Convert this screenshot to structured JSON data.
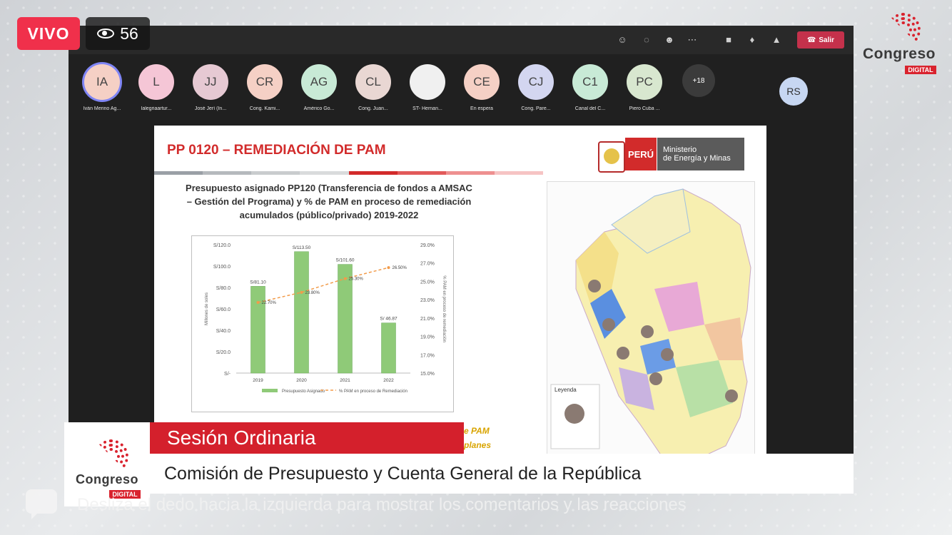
{
  "badges": {
    "live": "VIVO",
    "viewers": "56"
  },
  "logo": {
    "word": "Congreso",
    "tag": "DIGITAL"
  },
  "meeting": {
    "leave_label": "Salir",
    "participants": [
      {
        "initials": "IA",
        "name": "Iván Merino Ag...",
        "color": "#f5d0c5"
      },
      {
        "initials": "L",
        "name": "lalegriaartur...",
        "color": "#f5c6d6"
      },
      {
        "initials": "JJ",
        "name": "José Jerí (In...",
        "color": "#e6c9d3"
      },
      {
        "initials": "CR",
        "name": "Cong. Kami...",
        "color": "#f5d0c5"
      },
      {
        "initials": "AG",
        "name": "Américo Go...",
        "color": "#c8ead6"
      },
      {
        "initials": "CL",
        "name": "Cong. Juan...",
        "color": "#e9d7d3"
      },
      {
        "initials": "",
        "name": "ST- Hernan...",
        "color": "#f0f0f0"
      },
      {
        "initials": "CE",
        "name": "En espera",
        "color": "#f5d0c5"
      },
      {
        "initials": "CJ",
        "name": "Cong. Pare...",
        "color": "#d3d6f0"
      },
      {
        "initials": "C1",
        "name": "Canal del C...",
        "color": "#c8ead6"
      },
      {
        "initials": "PC",
        "name": "Piero Cuba ...",
        "color": "#d8e7cf"
      }
    ],
    "more": "+18",
    "self_initials": "RS"
  },
  "slide": {
    "title": "PP 0120 – REMEDIACIÓN DE PAM",
    "peru_label": "PERÚ",
    "ministry_line1": "Ministerio",
    "ministry_line2": "de Energía y Minas",
    "chart_title": "Presupuesto asignado PP120 (Transferencia de fondos a AMSAC – Gestión del Programa) y % de PAM en proceso de remediación acumulados (público/privado) 2019-2022",
    "side_text_1": "e PAM",
    "side_text_2": "planes",
    "map_legend": "Leyenda"
  },
  "chart_data": {
    "type": "bar",
    "categories": [
      "2019",
      "2020",
      "2021",
      "2022"
    ],
    "series": [
      {
        "name": "Presupuesto Asignado",
        "values": [
          81.1,
          113.5,
          101.6,
          46.87
        ],
        "labels": [
          "S/81.10",
          "S/113.50",
          "S/101.60",
          "S/ 46.87"
        ],
        "color": "#8fca78"
      },
      {
        "name": "% PAM en proceso de Remediación",
        "type": "line",
        "values": [
          22.7,
          23.8,
          25.3,
          26.5
        ],
        "labels": [
          "22.70%",
          "23.80%",
          "25.30%",
          "26.50%"
        ],
        "color": "#f29b4a"
      }
    ],
    "ylabel": "Millones de soles",
    "y2label": "% PAM en proceso de remediación",
    "ylim": [
      0,
      120
    ],
    "y2lim": [
      15,
      29
    ],
    "yticks": [
      "S/-",
      "S/20.0",
      "S/40.0",
      "S/60.0",
      "S/80.0",
      "S/100.0",
      "S/120.0"
    ],
    "y2ticks": [
      "15.0%",
      "17.0%",
      "19.0%",
      "21.0%",
      "23.0%",
      "25.0%",
      "27.0%",
      "29.0%"
    ]
  },
  "lower_third": {
    "session": "Sesión Ordinaria",
    "commission": "Comisión de Presupuesto y Cuenta General de la República"
  },
  "hint": "Desliza el dedo hacia la izquierda para mostrar los comentarios y las reacciones"
}
